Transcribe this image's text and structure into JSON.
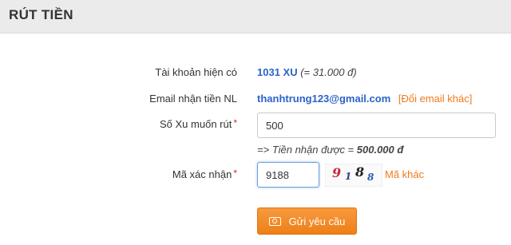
{
  "header": {
    "title": "RÚT TIỀN"
  },
  "account": {
    "label": "Tài khoản hiện có",
    "balance": "1031 XU",
    "balance_note": "(= 31.000 đ)"
  },
  "email": {
    "label": "Email nhận tiền NL",
    "value": "thanhtrung123@gmail.com",
    "change_link": "[Đổi email khác]"
  },
  "amount": {
    "label": "Số Xu muốn rút",
    "required_mark": "*",
    "value": "500",
    "result_prefix": "=> Tiền nhận được = ",
    "result_value": "500.000 đ"
  },
  "captcha": {
    "label": "Mã xác nhận",
    "required_mark": "*",
    "value": "9188",
    "chars": [
      "9",
      "1",
      "8",
      "8"
    ],
    "refresh_link": "Mã khác"
  },
  "submit": {
    "label": "Gửi yêu cầu",
    "icon": "money-icon"
  },
  "colors": {
    "accent_orange": "#f07b1e",
    "value_blue": "#2b63c6",
    "required_red": "#e0281e"
  }
}
